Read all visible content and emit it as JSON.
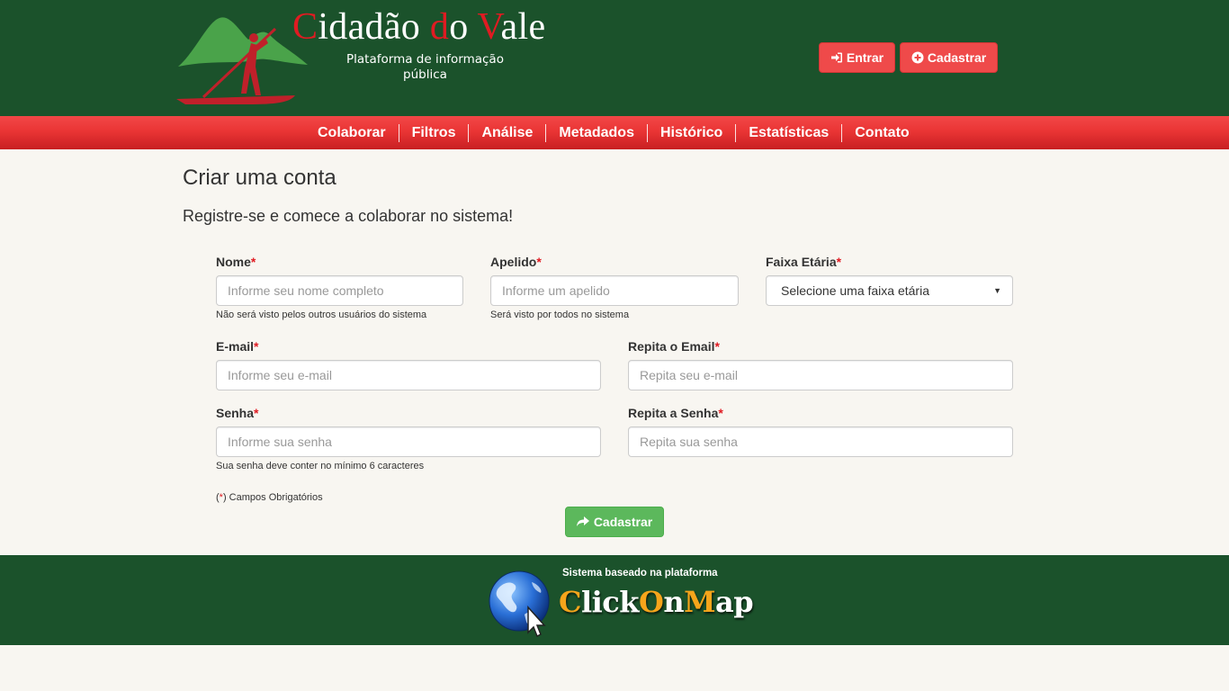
{
  "header": {
    "title_parts": [
      "C",
      "idadão ",
      "d",
      "o ",
      "V",
      "ale"
    ],
    "subtitle": "Plataforma de informação pública",
    "login_label": "Entrar",
    "register_label": "Cadastrar",
    "login_icon": "sign-in-icon",
    "register_icon": "plus-circle-icon"
  },
  "nav": {
    "items": [
      "Colaborar",
      "Filtros",
      "Análise",
      "Metadados",
      "Histórico",
      "Estatísticas",
      "Contato"
    ]
  },
  "main": {
    "title": "Criar uma conta",
    "subtitle": "Registre-se e comece a colaborar no sistema!",
    "required_mark": "*",
    "fields": {
      "nome": {
        "label": "Nome",
        "placeholder": "Informe seu nome completo",
        "help": "Não será visto pelos outros usuários do sistema"
      },
      "apelido": {
        "label": "Apelido",
        "placeholder": "Informe um apelido",
        "help": "Será visto por todos no sistema"
      },
      "faixa": {
        "label": "Faixa Etária",
        "selected": "Selecione uma faixa etária"
      },
      "email": {
        "label": "E-mail",
        "placeholder": "Informe seu e-mail"
      },
      "email_repeat": {
        "label": "Repita o Email",
        "placeholder": "Repita seu e-mail"
      },
      "senha": {
        "label": "Senha",
        "placeholder": "Informe sua senha",
        "help": "Sua senha deve conter no mínimo 6 caracteres"
      },
      "senha_repeat": {
        "label": "Repita a Senha",
        "placeholder": "Repita sua senha"
      }
    },
    "required_note_open": "(",
    "required_note_close": ") Campos Obrigatórios",
    "submit_label": "Cadastrar"
  },
  "footer": {
    "caption": "Sistema baseado na plataforma",
    "brand_parts": [
      "C",
      "lick",
      "O",
      "n",
      "M",
      "ap"
    ]
  },
  "colors": {
    "header_green": "#1b522b",
    "nav_red": "#ea3535",
    "accent_red": "#e01b22",
    "button_red": "#ef4a4a",
    "submit_green": "#5cb85c",
    "brand_orange": "#f6a51b"
  }
}
